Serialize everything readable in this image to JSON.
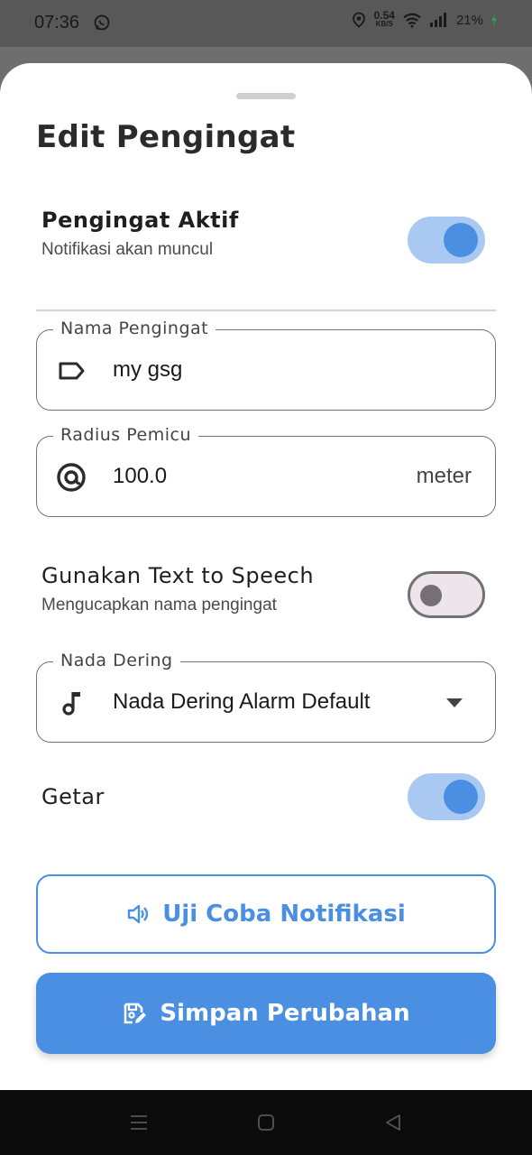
{
  "status_bar": {
    "time": "07:36",
    "speed_value": "0.54",
    "speed_unit": "KB/S",
    "battery": "21%"
  },
  "sheet": {
    "title": "Edit Pengingat"
  },
  "active_setting": {
    "title": "Pengingat Aktif",
    "subtitle": "Notifikasi akan muncul",
    "enabled": true
  },
  "name_field": {
    "label": "Nama Pengingat",
    "value": "my gsg",
    "icon": "label-icon"
  },
  "radius_field": {
    "label": "Radius Pemicu",
    "value": "100.0",
    "suffix": "meter",
    "icon": "radius-icon"
  },
  "tts_setting": {
    "title": "Gunakan Text to Speech",
    "subtitle": "Mengucapkan nama pengingat",
    "enabled": false
  },
  "ringtone_field": {
    "label": "Nada Dering",
    "value": "Nada Dering Alarm Default",
    "icon": "music-note-icon"
  },
  "vibrate_setting": {
    "title": "Getar",
    "enabled": true
  },
  "buttons": {
    "test_label": "Uji Coba Notifikasi",
    "save_label": "Simpan Perubahan"
  },
  "colors": {
    "accent": "#4a8fe2",
    "toggle_track_on": "#a9c9f3"
  }
}
